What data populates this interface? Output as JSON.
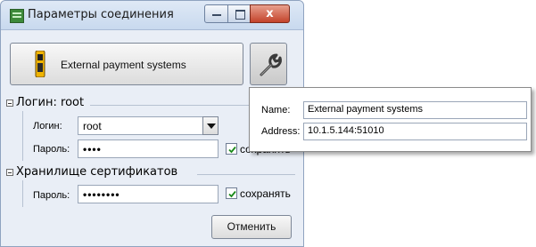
{
  "window": {
    "title": "Параметры соединения",
    "close_glyph": "x"
  },
  "main_button": {
    "label": "External payment systems",
    "icon": "payment-terminal-icon",
    "settings_icon": "wrench-icon"
  },
  "login_group": {
    "title": "Логин: root",
    "login_label": "Логин:",
    "login_value": "root",
    "password_label": "Пароль:",
    "password_value": "••••",
    "save_label": "сохранять",
    "save_checked": true
  },
  "cert_group": {
    "title": "Хранилище сертификатов",
    "password_label": "Пароль:",
    "password_value": "••••••••",
    "save_label": "сохранять",
    "save_checked": true
  },
  "cancel_label": "Отменить",
  "popup": {
    "name_label": "Name:",
    "name_value": "External payment systems",
    "address_label": "Address:",
    "address_value": "10.1.5.144:51010"
  }
}
